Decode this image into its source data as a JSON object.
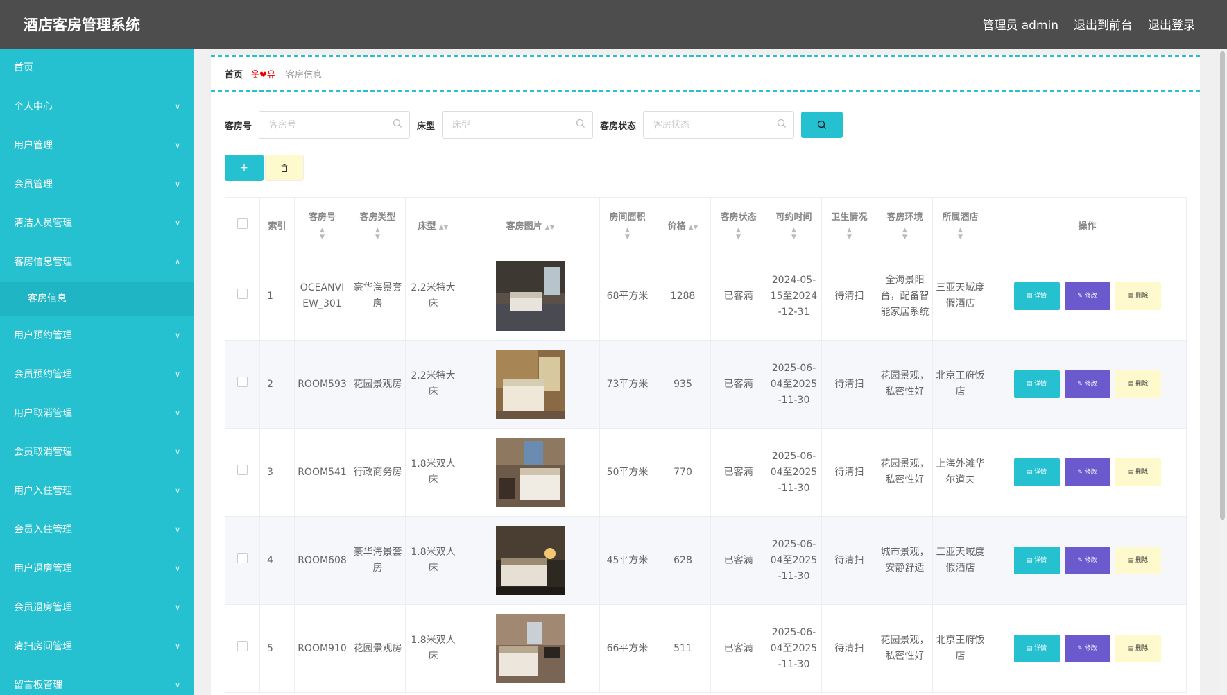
{
  "app": {
    "title": "酒店客房管理系统"
  },
  "header": {
    "admin": "管理员 admin",
    "front": "退出到前台",
    "logout": "退出登录"
  },
  "sidebar": {
    "items": [
      {
        "label": "首页",
        "chevron": false
      },
      {
        "label": "个人中心",
        "chevron": true
      },
      {
        "label": "用户管理",
        "chevron": true
      },
      {
        "label": "会员管理",
        "chevron": true
      },
      {
        "label": "清洁人员管理",
        "chevron": true
      },
      {
        "label": "客房信息管理",
        "chevron": true,
        "expanded": true
      }
    ],
    "sub_item": "客房信息",
    "items_after": [
      "用户预约管理",
      "会员预约管理",
      "用户取消管理",
      "会员取消管理",
      "用户入住管理",
      "会员入住管理",
      "用户退房管理",
      "会员退房管理",
      "清扫房间管理",
      "留言板管理"
    ]
  },
  "breadcrumb": {
    "home": "首页",
    "sep": "웃❤유",
    "current": "客房信息"
  },
  "search": {
    "room_no_label": "客房号",
    "room_no_placeholder": "客房号",
    "bed_label": "床型",
    "bed_placeholder": "床型",
    "status_label": "客房状态",
    "status_placeholder": "客房状态"
  },
  "actions": {
    "add": "+"
  },
  "table": {
    "headers": [
      "索引",
      "客房号",
      "客房类型",
      "床型",
      "客房图片",
      "房间面积",
      "价格",
      "客房状态",
      "可约时间",
      "卫生情况",
      "客房环境",
      "所属酒店",
      "操作"
    ],
    "rows": [
      {
        "index": "1",
        "room_no": "OCEANVIEW_301",
        "type": "豪华海景套房",
        "bed": "2.2米特大床",
        "area": "68平方米",
        "price": "1288",
        "status": "已客满",
        "time": "2024-05-15至2024-12-31",
        "hygiene": "待清扫",
        "env": "全海景阳台，配备智能家居系统",
        "hotel": "三亚天域度假酒店"
      },
      {
        "index": "2",
        "room_no": "ROOM593",
        "type": "花园景观房",
        "bed": "2.2米特大床",
        "area": "73平方米",
        "price": "935",
        "status": "已客满",
        "time": "2025-06-04至2025-11-30",
        "hygiene": "待清扫",
        "env": "花园景观，私密性好",
        "hotel": "北京王府饭店"
      },
      {
        "index": "3",
        "room_no": "ROOM541",
        "type": "行政商务房",
        "bed": "1.8米双人床",
        "area": "50平方米",
        "price": "770",
        "status": "已客满",
        "time": "2025-06-04至2025-11-30",
        "hygiene": "待清扫",
        "env": "花园景观，私密性好",
        "hotel": "上海外滩华尔道夫"
      },
      {
        "index": "4",
        "room_no": "ROOM608",
        "type": "豪华海景套房",
        "bed": "1.8米双人床",
        "area": "45平方米",
        "price": "628",
        "status": "已客满",
        "time": "2025-06-04至2025-11-30",
        "hygiene": "待清扫",
        "env": "城市景观，安静舒适",
        "hotel": "三亚天域度假酒店"
      },
      {
        "index": "5",
        "room_no": "ROOM910",
        "type": "花园景观房",
        "bed": "1.8米双人床",
        "area": "66平方米",
        "price": "511",
        "status": "已客满",
        "time": "2025-06-04至2025-11-30",
        "hygiene": "待清扫",
        "env": "花园景观，私密性好",
        "hotel": "北京王府饭店"
      }
    ],
    "ops": {
      "detail": "详情",
      "edit": "修改",
      "delete": "删除"
    }
  },
  "colors": {
    "accent": "#26c1d1",
    "header": "#4d4d4d",
    "edit": "#6a5acd",
    "delete_bg": "#fffacd"
  }
}
